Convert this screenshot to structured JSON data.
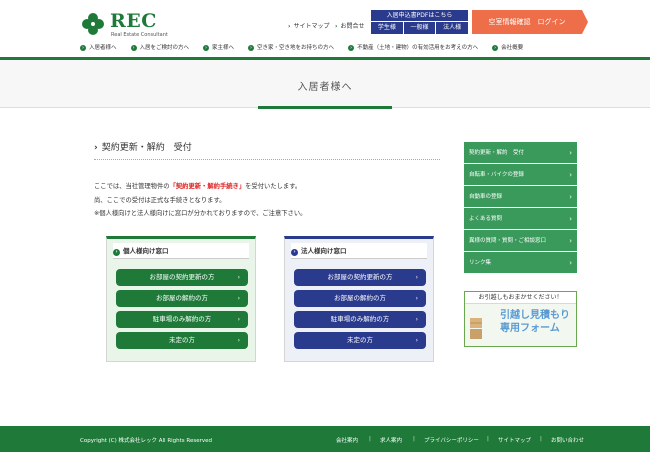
{
  "brand": {
    "name": "REC",
    "subtitle": "Real Estate Consultant",
    "arc_text": "Real Estate Consultant"
  },
  "utility": {
    "sitemap": "サイトマップ",
    "contact": "お問合せ"
  },
  "pdf": {
    "title": "入居申込書PDFはこちら",
    "buttons": [
      "学生様",
      "一般様",
      "法人様"
    ]
  },
  "login": {
    "label": "空室情報確認　ログイン"
  },
  "global_nav": [
    "入居者様へ",
    "入居をご検討の方へ",
    "家主様へ",
    "空き家・空き地をお持ちの方へ",
    "不動産（土地・建物）の有効活用をお考えの方へ",
    "会社概要"
  ],
  "hero": {
    "title": "入居者様へ"
  },
  "section": {
    "title": "契約更新・解約　受付"
  },
  "intro": {
    "line1_pre": "ここでは、当社管理物件の",
    "line1_highlight": "「契約更新・解約手続き」",
    "line1_post": "を受付いたします。",
    "line2": "尚、ここでの受付は正式な手続きとなります。",
    "line3": "※個人様向けと法人様向けに窓口が分かれておりますので、ご注意下さい。"
  },
  "personal": {
    "title": "個人様向け窓口",
    "buttons": [
      "お部屋の契約更新の方",
      "お部屋の解約の方",
      "駐車場のみ解約の方",
      "未定の方"
    ]
  },
  "corporate": {
    "title": "法人様向け窓口",
    "buttons": [
      "お部屋の契約更新の方",
      "お部屋の解約の方",
      "駐車場のみ解約の方",
      "未定の方"
    ]
  },
  "sidebar": {
    "items": [
      "契約更新・解約　受付",
      "自転車・バイクの登録",
      "自動車の登録",
      "よくある質問",
      "異様の質問・質問・ご相談窓口",
      "リンク集"
    ]
  },
  "banner": {
    "top": "お引越しもおまかせください！",
    "line1": "引越し見積もり",
    "line2": "専用フォーム"
  },
  "footer": {
    "copyright": "Copyright (C) 株式会社レック All Rights Reserved",
    "links": [
      "会社案内",
      "求人案内",
      "プライバシーポリシー",
      "サイトマップ",
      "お問い合わせ"
    ]
  },
  "colors": {
    "brand_green": "#1f7a3a",
    "navy": "#2a3a8c",
    "login_orange": "#ee6e4a",
    "sidebar_green": "#3a9a5c"
  }
}
